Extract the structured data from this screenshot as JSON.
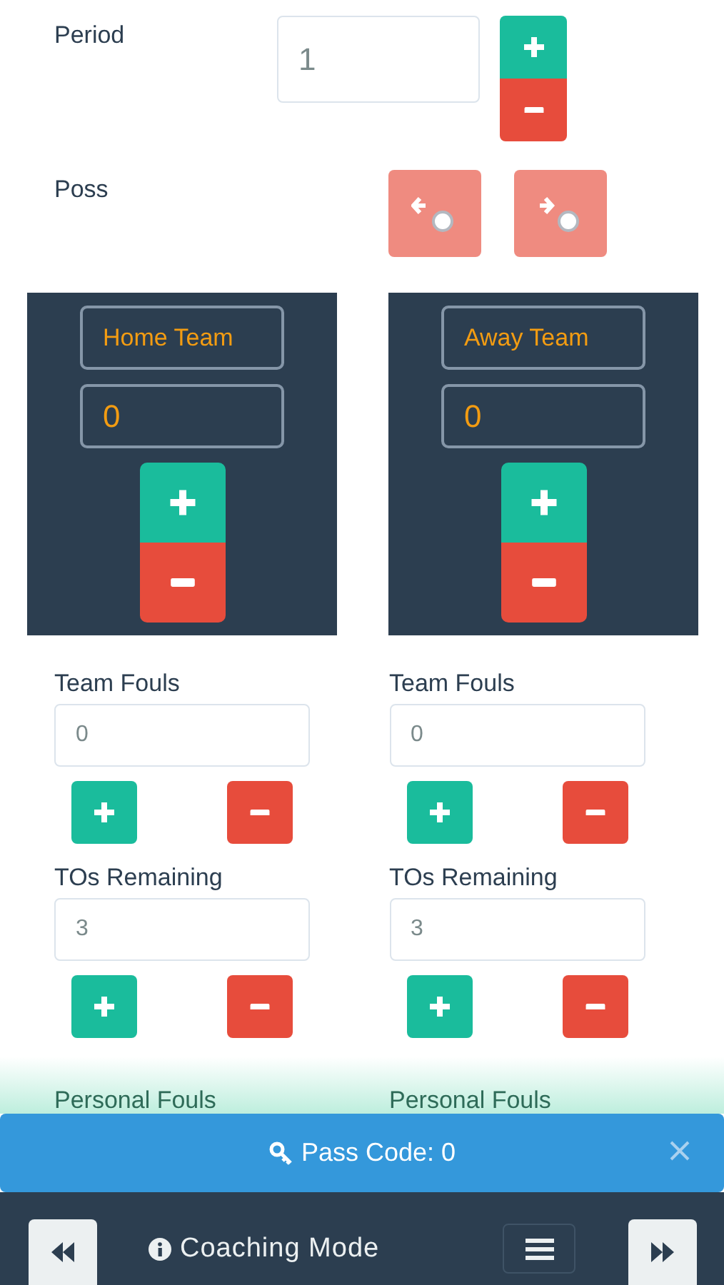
{
  "period": {
    "label": "Period",
    "value": "1"
  },
  "possession": {
    "label": "Poss",
    "buttons": [
      {
        "kind": "left"
      },
      {
        "kind": "right"
      }
    ]
  },
  "teams": [
    {
      "name": "Home Team",
      "score": "0",
      "stats": [
        {
          "label": "Team Fouls",
          "value": "0"
        },
        {
          "label": "TOs Remaining",
          "value": "3"
        }
      ],
      "personal_fouls_label": "Personal Fouls"
    },
    {
      "name": "Away Team",
      "score": "0",
      "stats": [
        {
          "label": "Team Fouls",
          "value": "0"
        },
        {
          "label": "TOs Remaining",
          "value": "3"
        }
      ],
      "personal_fouls_label": "Personal Fouls"
    }
  ],
  "banner": {
    "text": "Pass Code: 0"
  },
  "bottom_bar": {
    "mode": "Coaching Mode"
  }
}
